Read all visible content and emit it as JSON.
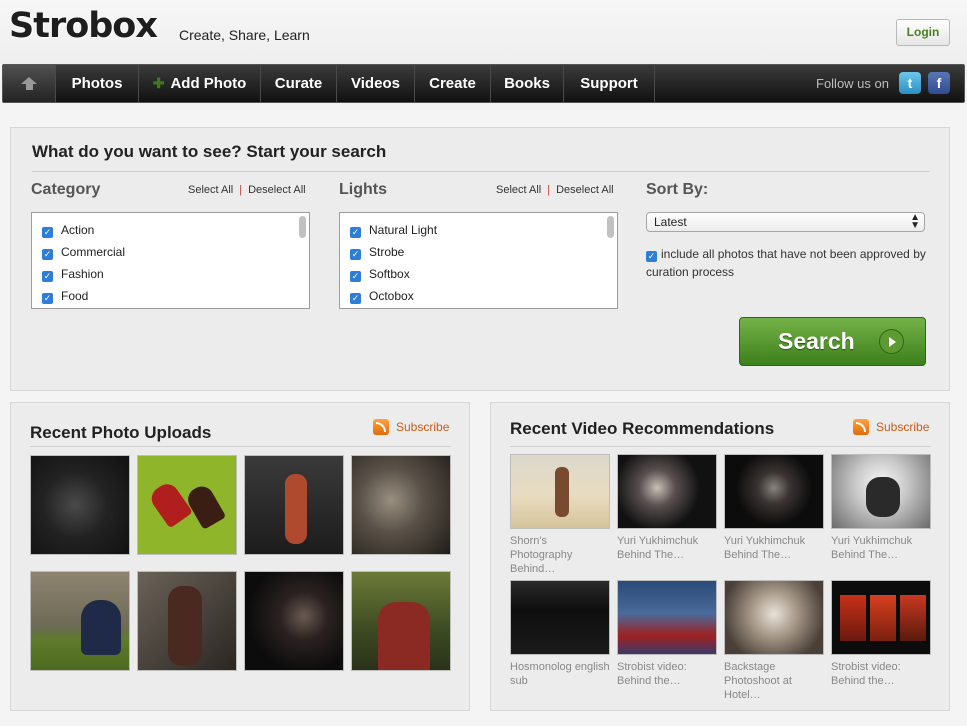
{
  "header": {
    "logo": "Strobox",
    "tagline": "Create, Share, Learn",
    "login_label": "Login"
  },
  "nav": {
    "items": [
      "Photos",
      "Add Photo",
      "Curate",
      "Videos",
      "Create",
      "Books",
      "Support"
    ],
    "follow_label": "Follow us on"
  },
  "search": {
    "title": "What do you want to see? Start your search",
    "select_all": "Select All",
    "deselect_all": "Deselect All",
    "category": {
      "heading": "Category",
      "items": [
        "Action",
        "Commercial",
        "Fashion",
        "Food"
      ]
    },
    "lights": {
      "heading": "Lights",
      "items": [
        "Natural Light",
        "Strobe",
        "Softbox",
        "Octobox"
      ]
    },
    "sort": {
      "heading": "Sort By:",
      "selected": "Latest",
      "approval_checkbox_label": "include all photos that have not been approved by curation process"
    },
    "button_label": "Search"
  },
  "photos": {
    "title": "Recent Photo Uploads",
    "subscribe_label": "Subscribe"
  },
  "videos": {
    "title": "Recent Video Recommendations",
    "subscribe_label": "Subscribe",
    "captions": [
      [
        "Shorn's",
        "Photography",
        "Behind…"
      ],
      [
        "Yuri Yukhimchuk",
        "Behind The…"
      ],
      [
        "Yuri Yukhimchuk",
        "Behind The…"
      ],
      [
        "Yuri Yukhimchuk",
        "Behind The…"
      ],
      [
        "Hosmonolog english",
        "sub"
      ],
      [
        "Strobist video:",
        "Behind the…"
      ],
      [
        "Backstage",
        "Photoshoot at",
        "Hotel…"
      ],
      [
        "Strobist video:",
        "Behind the…"
      ]
    ]
  },
  "colors": {
    "accent_green": "#4c8c24",
    "subscribe_orange": "#d35a13",
    "checkbox_blue": "#2d7ed9"
  }
}
